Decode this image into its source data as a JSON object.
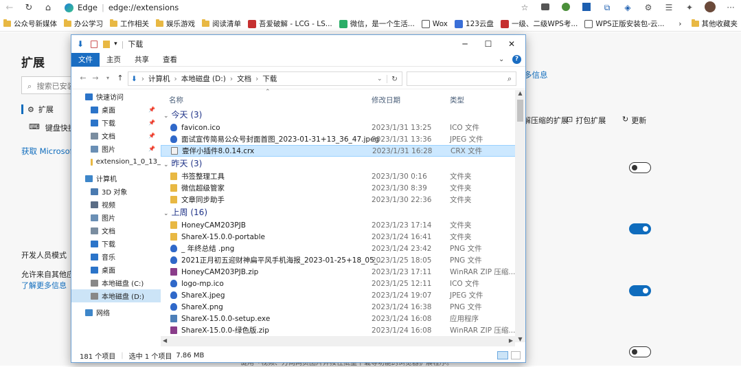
{
  "browser": {
    "edge_label": "Edge",
    "url": "edge://extensions"
  },
  "bookmarks": [
    {
      "label": "公众号新媒体",
      "icon": "folder-icon"
    },
    {
      "label": "办公学习",
      "icon": "folder-icon"
    },
    {
      "label": "工作相关",
      "icon": "folder-icon"
    },
    {
      "label": "娱乐游戏",
      "icon": "folder-icon"
    },
    {
      "label": "阅读清单",
      "icon": "folder-icon"
    },
    {
      "label": "吾爱破解 - LCG - LS...",
      "icon": "site-icon"
    },
    {
      "label": "微信，是一个生活...",
      "icon": "wechat-icon"
    },
    {
      "label": "Wox",
      "icon": "page-icon"
    },
    {
      "label": "123云盘",
      "icon": "cloud-icon"
    },
    {
      "label": "一级、二级WPS考...",
      "icon": "site-icon"
    },
    {
      "label": "WPS正版安装包-云...",
      "icon": "page-icon"
    }
  ],
  "bookmarks_more": "其他收藏夹",
  "extensions": {
    "title": "扩展",
    "search_placeholder": "搜索已安装的扩展",
    "nav_extensions": "扩展",
    "nav_shortcuts": "键盘快捷方式",
    "get_extensions": "获取 Microsoft Edge 扩展",
    "dev_mode": "开发人员模式",
    "allow_other": "允许来自其他应用商店的扩展",
    "learn_more": "了解更多信息",
    "more_info": "多信息",
    "load_unpacked": "解压缩的扩展",
    "pack": "打包扩展",
    "update": "更新",
    "bottom_text": "一键用「视频、万向网页图片并按住批量下载等功能的浏览器扩展程序。"
  },
  "explorer": {
    "title": "下载",
    "tabs": [
      "文件",
      "主页",
      "共享",
      "查看"
    ],
    "breadcrumb": [
      "计算机",
      "本地磁盘 (D:)",
      "文档",
      "下载"
    ],
    "columns": {
      "name": "名称",
      "date": "修改日期",
      "type": "类型"
    },
    "sidebar": [
      {
        "label": "快速访问",
        "icon": "star-icon",
        "pin": false,
        "indent": 0
      },
      {
        "label": "桌面",
        "icon": "desktop-icon",
        "pin": true,
        "indent": 1
      },
      {
        "label": "下载",
        "icon": "download-icon",
        "pin": true,
        "indent": 1
      },
      {
        "label": "文档",
        "icon": "document-icon",
        "pin": true,
        "indent": 1
      },
      {
        "label": "图片",
        "icon": "picture-icon",
        "pin": true,
        "indent": 1
      },
      {
        "label": "extension_1_0_13_",
        "icon": "folder-icon",
        "pin": false,
        "indent": 1
      },
      {
        "label": "计算机",
        "icon": "computer-icon",
        "pin": false,
        "indent": 0
      },
      {
        "label": "3D 对象",
        "icon": "3d-icon",
        "pin": false,
        "indent": 1
      },
      {
        "label": "视频",
        "icon": "video-icon",
        "pin": false,
        "indent": 1
      },
      {
        "label": "图片",
        "icon": "picture-icon",
        "pin": false,
        "indent": 1
      },
      {
        "label": "文档",
        "icon": "document-icon",
        "pin": false,
        "indent": 1
      },
      {
        "label": "下载",
        "icon": "download-icon",
        "pin": false,
        "indent": 1
      },
      {
        "label": "音乐",
        "icon": "music-icon",
        "pin": false,
        "indent": 1
      },
      {
        "label": "桌面",
        "icon": "desktop-icon",
        "pin": false,
        "indent": 1
      },
      {
        "label": "本地磁盘 (C:)",
        "icon": "drive-icon",
        "pin": false,
        "indent": 1
      },
      {
        "label": "本地磁盘 (D:)",
        "icon": "drive-icon",
        "pin": false,
        "indent": 1,
        "selected": true
      },
      {
        "label": "网络",
        "icon": "network-icon",
        "pin": false,
        "indent": 0
      }
    ],
    "groups": [
      {
        "label": "今天 (3)",
        "files": [
          {
            "name": "favicon.ico",
            "date": "2023/1/31 13:25",
            "type": "ICO 文件",
            "icon": "image-file-icon"
          },
          {
            "name": "面试宣传简易公众号封面首图_2023-01-31+13_36_47.jpeg",
            "date": "2023/1/31 13:36",
            "type": "JPEG 文件",
            "icon": "image-file-icon"
          },
          {
            "name": "壹伴小插件8.0.14.crx",
            "date": "2023/1/31 16:28",
            "type": "CRX 文件",
            "icon": "file-icon",
            "selected": true
          }
        ]
      },
      {
        "label": "昨天 (3)",
        "files": [
          {
            "name": "书签整理工具",
            "date": "2023/1/30 0:16",
            "type": "文件夹",
            "icon": "folder-icon"
          },
          {
            "name": "微信超级管家",
            "date": "2023/1/30 8:39",
            "type": "文件夹",
            "icon": "folder-icon"
          },
          {
            "name": "文章同步助手",
            "date": "2023/1/30 22:36",
            "type": "文件夹",
            "icon": "folder-icon"
          }
        ]
      },
      {
        "label": "上周 (16)",
        "files": [
          {
            "name": "HoneyCAM203PJB",
            "date": "2023/1/23 17:14",
            "type": "文件夹",
            "icon": "folder-icon"
          },
          {
            "name": "ShareX-15.0.0-portable",
            "date": "2023/1/24 16:41",
            "type": "文件夹",
            "icon": "folder-icon"
          },
          {
            "name": "_      年终总结      .png",
            "date": "2023/1/24 23:42",
            "type": "PNG 文件",
            "icon": "image-file-icon"
          },
          {
            "name": "2021正月初五迎财神扁平风手机海报_2023-01-25+18_05_...",
            "date": "2023/1/25 18:05",
            "type": "PNG 文件",
            "icon": "image-file-icon"
          },
          {
            "name": "HoneyCAM203PJB.zip",
            "date": "2023/1/23 17:11",
            "type": "WinRAR ZIP 压缩...",
            "icon": "archive-icon"
          },
          {
            "name": "logo-mp.ico",
            "date": "2023/1/25 12:11",
            "type": "ICO 文件",
            "icon": "image-file-icon"
          },
          {
            "name": "ShareX.jpeg",
            "date": "2023/1/24 19:07",
            "type": "JPEG 文件",
            "icon": "image-file-icon"
          },
          {
            "name": "ShareX.png",
            "date": "2023/1/24 16:38",
            "type": "PNG 文件",
            "icon": "image-file-icon"
          },
          {
            "name": "ShareX-15.0.0-setup.exe",
            "date": "2023/1/24 16:08",
            "type": "应用程序",
            "icon": "exe-icon"
          },
          {
            "name": "ShareX-15.0.0-绿色版.zip",
            "date": "2023/1/24 16:08",
            "type": "WinRAR ZIP 压缩...",
            "icon": "archive-icon"
          }
        ]
      }
    ],
    "status_count": "181 个项目",
    "status_selected": "选中 1 个项目",
    "status_size": "7.86 MB"
  },
  "colors": {
    "accent": "#0f6cbd",
    "folder": "#e8b843",
    "file_tab": "#1a6dc2"
  }
}
